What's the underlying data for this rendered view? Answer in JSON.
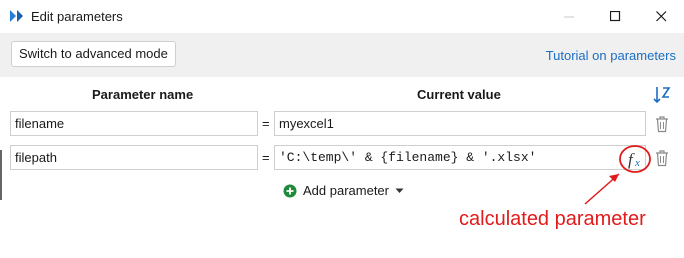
{
  "window": {
    "title": "Edit parameters",
    "controls": [
      "minimize",
      "maximize",
      "close"
    ]
  },
  "toolbar": {
    "advanced_mode_label": "Switch to advanced mode",
    "tutorial_link": "Tutorial on parameters"
  },
  "table": {
    "headers": {
      "name": "Parameter name",
      "value": "Current value"
    },
    "rows": [
      {
        "name": "filename",
        "equals": "=",
        "value": "myexcel1",
        "calculated": false
      },
      {
        "name": "filepath",
        "equals": "=",
        "value": "'C:\\temp\\' & {filename} & '.xlsx'",
        "calculated": true
      }
    ]
  },
  "actions": {
    "add_parameter_label": "Add parameter"
  },
  "annotation": {
    "text": "calculated parameter"
  },
  "icons": {
    "app": "power-query-icon",
    "sort": "sort-icon",
    "delete": "trash-icon",
    "formula": "fx-icon",
    "add": "plus-circle-icon",
    "dropdown": "caret-down-icon"
  },
  "colors": {
    "accent_link": "#1b6ec2",
    "add_icon": "#1f8a3b",
    "annotation_red": "#e01b1b",
    "fx_blue": "#1b6ec2"
  }
}
